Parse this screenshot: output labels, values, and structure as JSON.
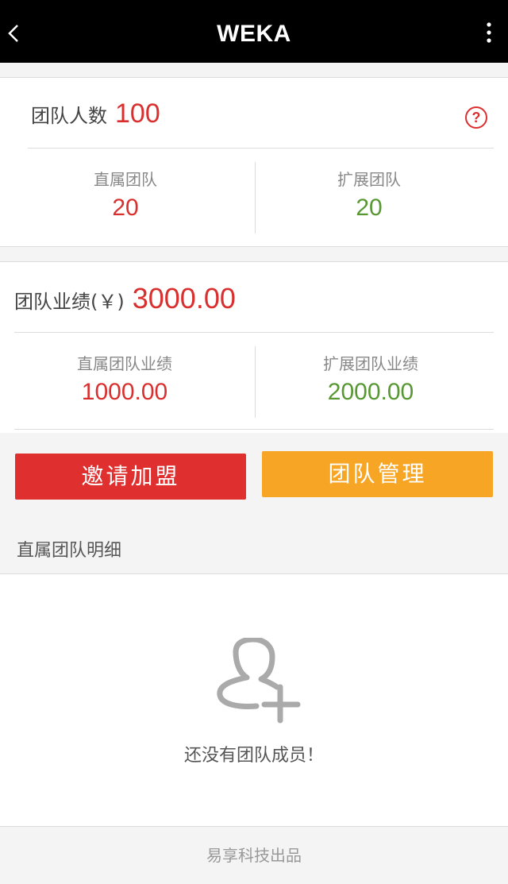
{
  "header": {
    "title": "WEKA"
  },
  "team_count": {
    "label": "团队人数",
    "value": "100"
  },
  "direct_team": {
    "label": "直属团队",
    "value": "20"
  },
  "extended_team": {
    "label": "扩展团队",
    "value": "20"
  },
  "team_performance": {
    "label": "团队业绩(￥)",
    "value": "3000.00"
  },
  "direct_performance": {
    "label": "直属团队业绩",
    "value": "1000.00"
  },
  "extended_performance": {
    "label": "扩展团队业绩",
    "value": "2000.00"
  },
  "buttons": {
    "invite": "邀请加盟",
    "manage": "团队管理"
  },
  "section": {
    "title": "直属团队明细"
  },
  "empty_state": {
    "text": "还没有团队成员！"
  },
  "footer": {
    "text": "易享科技出品"
  },
  "colors": {
    "red": "#d9302f",
    "green": "#579832",
    "orange": "#f6a524",
    "header_bg": "#000000"
  }
}
